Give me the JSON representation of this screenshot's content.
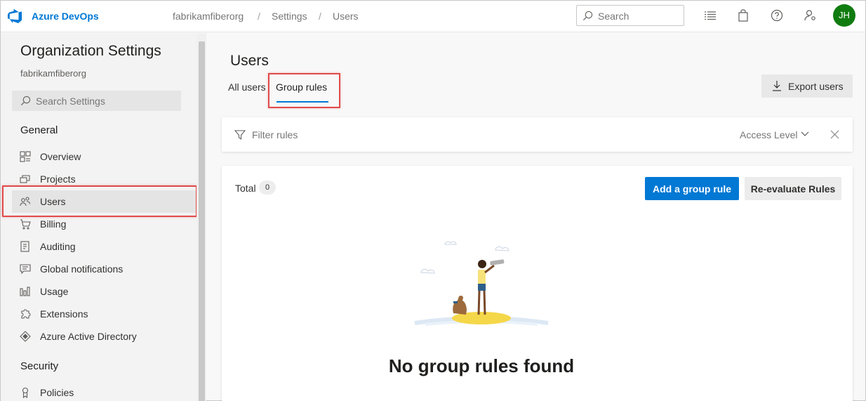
{
  "header": {
    "brand": "Azure DevOps",
    "breadcrumb": [
      "fabrikamfiberorg",
      "Settings",
      "Users"
    ],
    "separator": "/",
    "search_placeholder": "Search",
    "avatar_initials": "JH",
    "icons": [
      "list-icon",
      "shopping-bag-icon",
      "help-icon",
      "user-settings-icon"
    ],
    "accent_color": "#0078d4",
    "avatar_color": "#107c10"
  },
  "sidebar": {
    "title": "Organization Settings",
    "subtitle": "fabrikamfiberorg",
    "search_placeholder": "Search Settings",
    "sections": [
      {
        "heading": "General",
        "items": [
          {
            "label": "Overview",
            "icon": "overview-icon"
          },
          {
            "label": "Projects",
            "icon": "projects-icon"
          },
          {
            "label": "Users",
            "icon": "users-icon",
            "active": true
          },
          {
            "label": "Billing",
            "icon": "cart-icon"
          },
          {
            "label": "Auditing",
            "icon": "auditing-icon"
          },
          {
            "label": "Global notifications",
            "icon": "notification-icon"
          },
          {
            "label": "Usage",
            "icon": "usage-icon"
          },
          {
            "label": "Extensions",
            "icon": "extensions-icon"
          },
          {
            "label": "Azure Active Directory",
            "icon": "aad-icon"
          }
        ]
      },
      {
        "heading": "Security",
        "items": [
          {
            "label": "Policies",
            "icon": "policies-icon"
          }
        ]
      }
    ]
  },
  "main": {
    "title": "Users",
    "tabs": [
      {
        "label": "All users",
        "active": false
      },
      {
        "label": "Group rules",
        "active": true
      }
    ],
    "export_label": "Export users",
    "filter": {
      "placeholder": "Filter rules",
      "access_level_label": "Access Level"
    },
    "card": {
      "total_label": "Total",
      "total_count": "0",
      "add_rule_label": "Add a group rule",
      "reevaluate_label": "Re-evaluate Rules",
      "empty_title": "No group rules found"
    }
  }
}
